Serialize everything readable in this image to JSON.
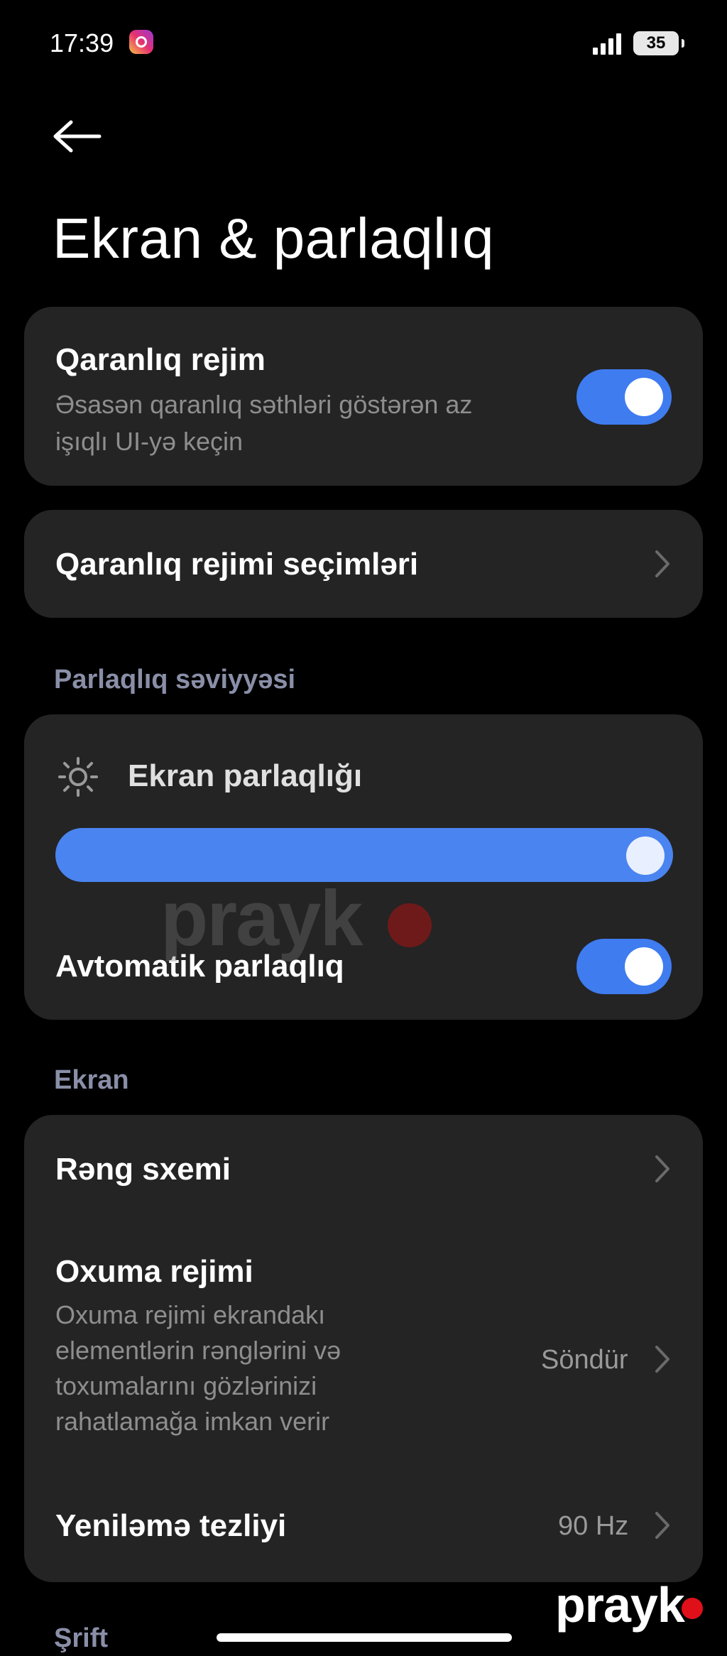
{
  "status_bar": {
    "time": "17:39",
    "battery": "35"
  },
  "header": {
    "title": "Ekran & parlaqlıq"
  },
  "dark_mode": {
    "title": "Qaranlıq rejim",
    "subtitle_line1": "Əsasən qaranlıq səthləri göstərən az",
    "subtitle_line2": "işıqlı UI-yə keçin",
    "enabled": true
  },
  "dark_mode_options": {
    "label": "Qaranlıq rejimi seçimləri"
  },
  "brightness_section": {
    "header": "Parlaqlıq səviyyəsi",
    "label": "Ekran parlaqlığı",
    "level": 1.0,
    "auto_label": "Avtomatik parlaqlıq",
    "auto_enabled": true
  },
  "display_section": {
    "header": "Ekran",
    "color_scheme": {
      "label": "Rəng sxemi"
    },
    "reading_mode": {
      "title": "Oxuma rejimi",
      "desc_line1": "Oxuma rejimi ekrandakı",
      "desc_line2": "elementlərin rənglərini və",
      "desc_line3": "toxumalarını gözlərinizi",
      "desc_line4": "rahatlamağa imkan verir",
      "value": "Söndür"
    },
    "refresh_rate": {
      "label": "Yeniləmə tezliyi",
      "value": "90 Hz"
    }
  },
  "font_section": {
    "header": "Şrift"
  },
  "watermark": {
    "text": "prayk"
  },
  "colors": {
    "accent": "#3f7cf0",
    "card": "#242424",
    "section_header": "#8a8fa8"
  }
}
